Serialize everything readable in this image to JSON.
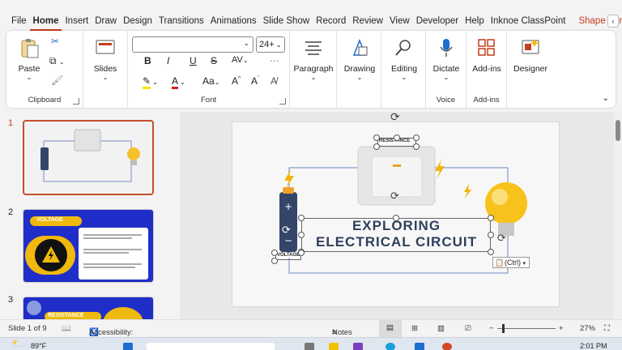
{
  "menu": {
    "tabs": [
      "File",
      "Home",
      "Insert",
      "Draw",
      "Design",
      "Transitions",
      "Animations",
      "Slide Show",
      "Record",
      "Review",
      "View",
      "Developer",
      "Help",
      "Inknoe ClassPoint"
    ],
    "active_tab": "Home",
    "shape_format": "Shape Format"
  },
  "ribbon": {
    "clipboard": {
      "paste": "Paste",
      "label": "Clipboard"
    },
    "slides": {
      "label": "Slides"
    },
    "font": {
      "size": "24+",
      "label": "Font",
      "bold": "B",
      "italic": "I",
      "underline": "U",
      "strike": "S",
      "spacing": "AV",
      "clear": "Aa",
      "grow": "A",
      "shrink": "A"
    },
    "paragraph": {
      "label": "Paragraph"
    },
    "drawing": {
      "label": "Drawing"
    },
    "editing": {
      "label": "Editing"
    },
    "voice": {
      "dictate": "Dictate",
      "label": "Voice"
    },
    "addins": {
      "addins": "Add-ins",
      "label": "Add-ins"
    },
    "designer": {
      "label": "Designer"
    }
  },
  "thumbnails": {
    "items": [
      {
        "num": "1"
      },
      {
        "num": "2",
        "title": "VOLTAGE"
      },
      {
        "num": "3",
        "title": "RESISTANCE"
      }
    ]
  },
  "slide": {
    "title_line1": "EXPLORING",
    "title_line2": "ELECTRICAL CIRCUIT",
    "label_resistance": "RESISTANCE",
    "label_voltage": "VOLTAGE",
    "paste_tag": "(Ctrl)"
  },
  "status": {
    "slide_info": "Slide 1 of 9",
    "accessibility": "Accessibility: Investigate",
    "notes": "Notes",
    "zoom": "27%"
  },
  "taskbar": {
    "weather": "89°F",
    "time": "2:01 PM"
  },
  "colors": {
    "accent": "#c43e1c",
    "slide_title": "#2f3f5c",
    "thumb_blue": "#1f2ec8"
  }
}
